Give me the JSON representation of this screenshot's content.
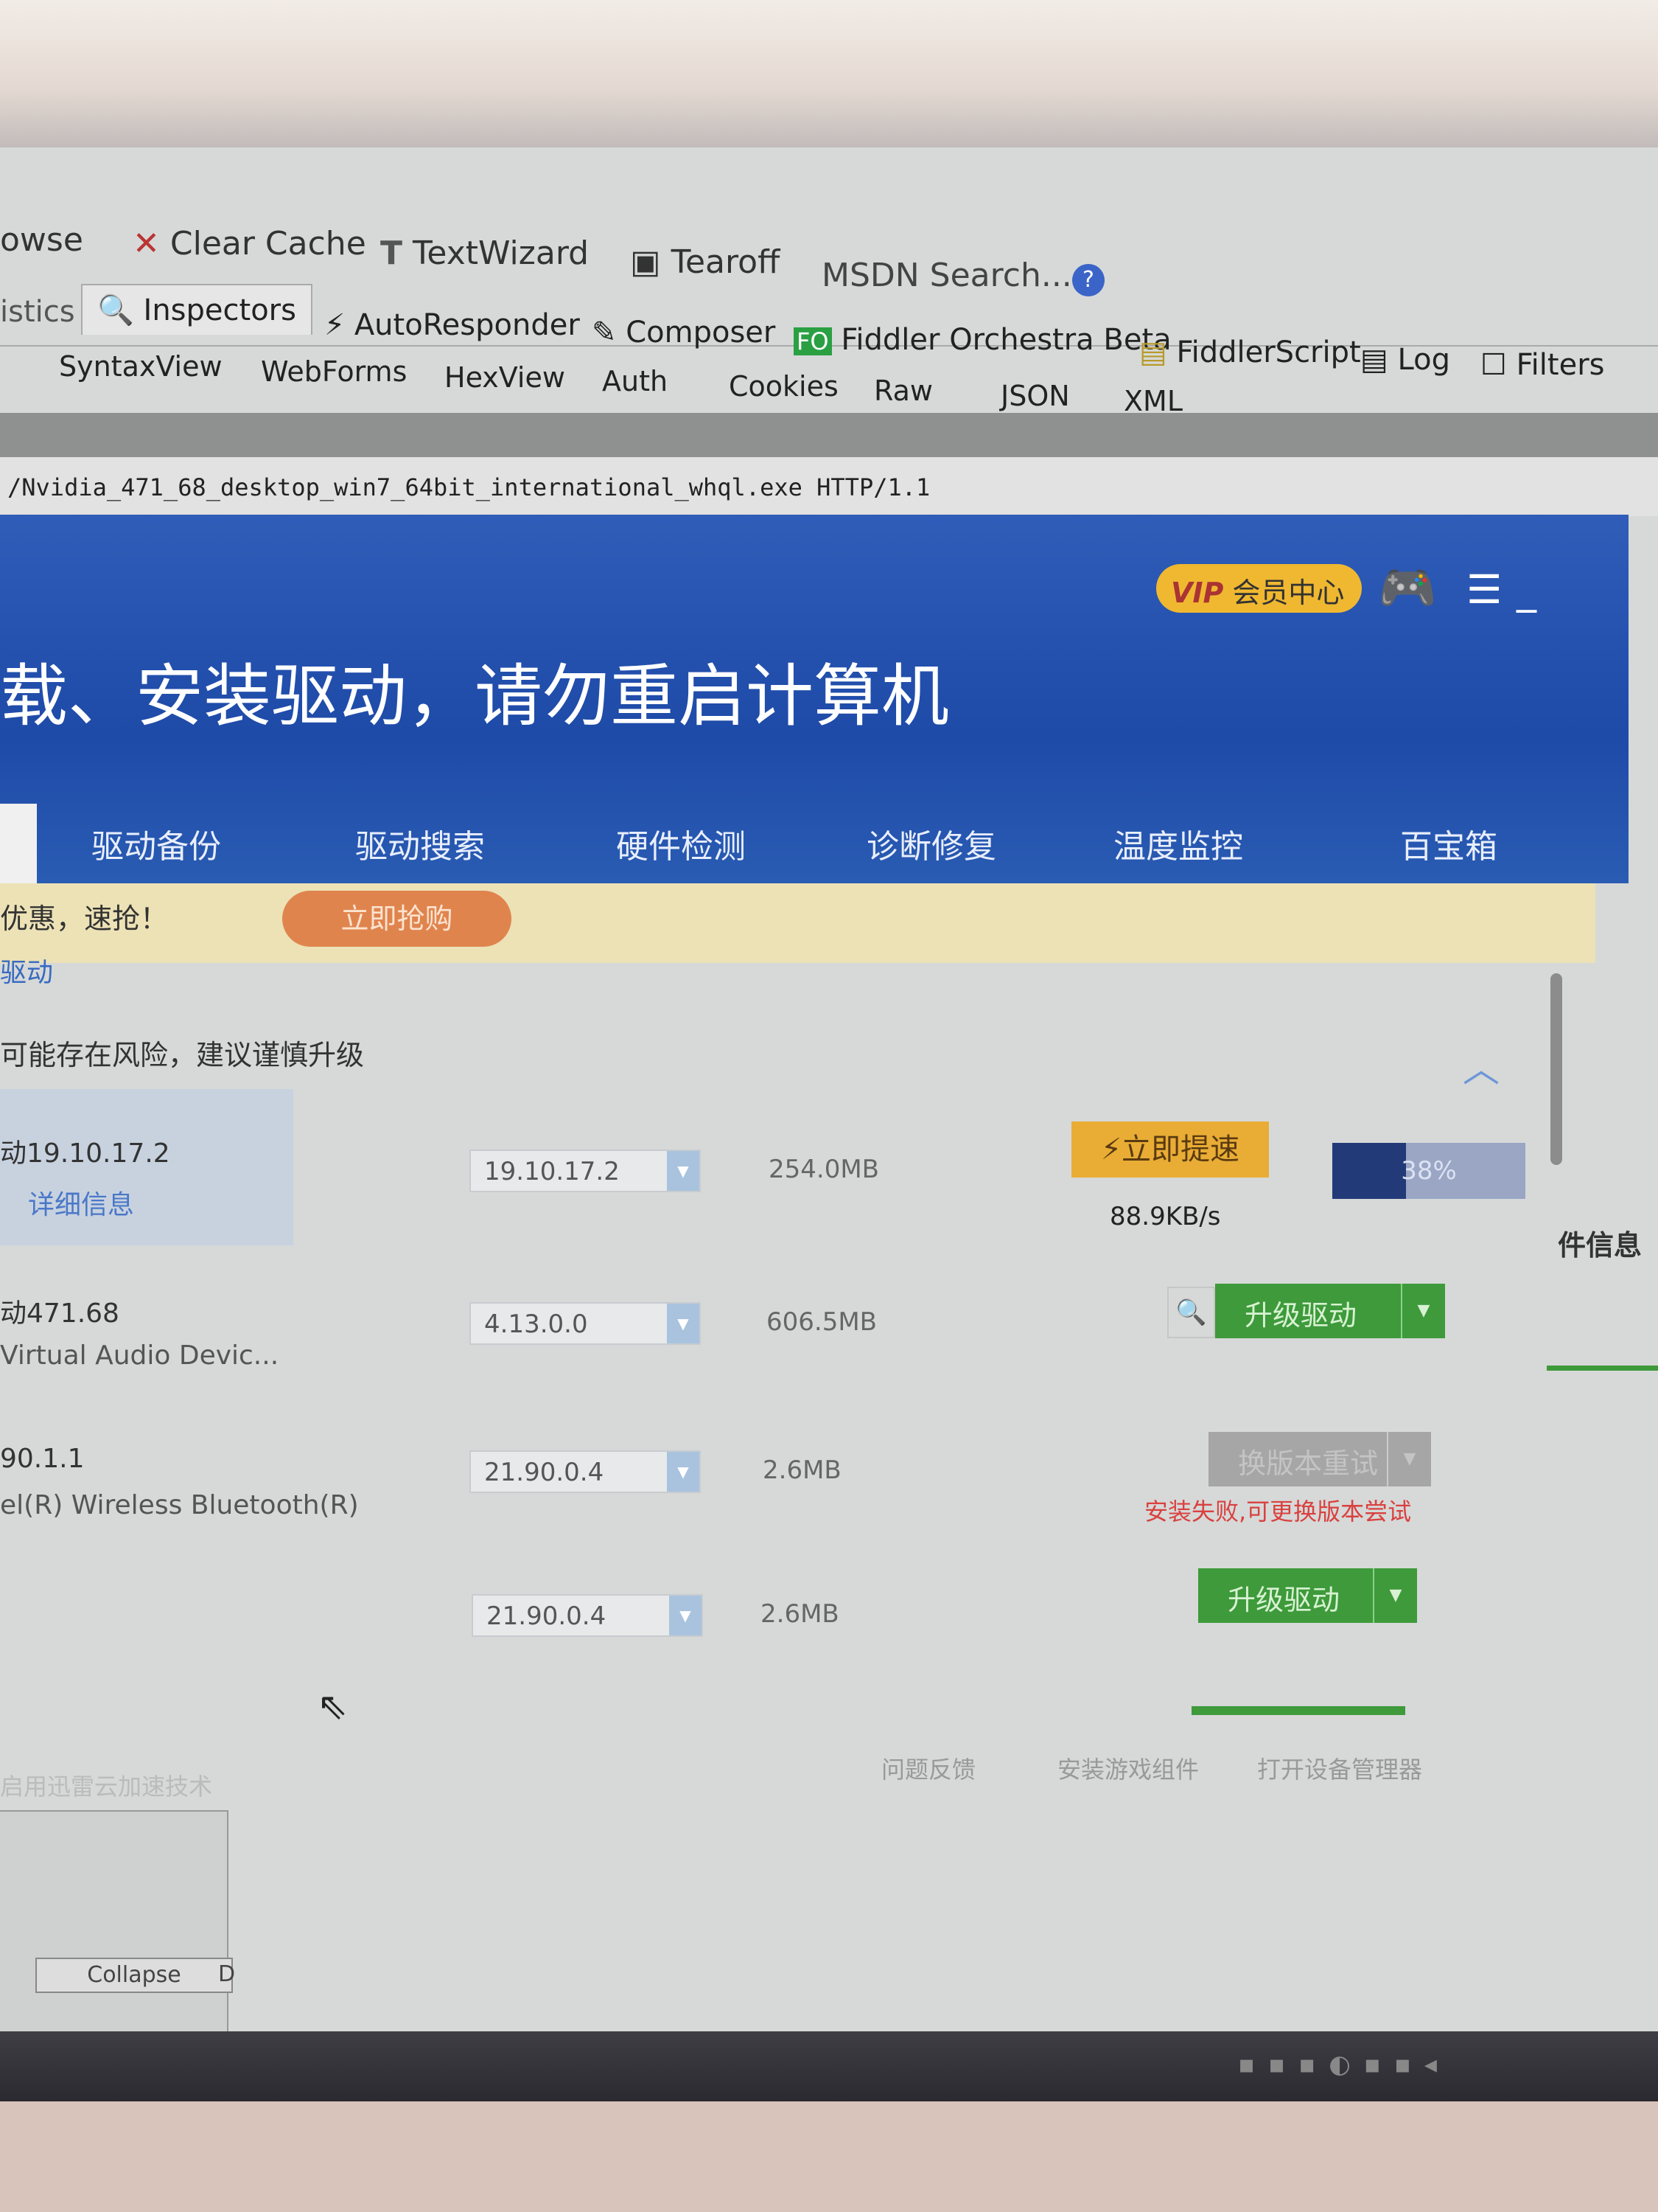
{
  "fiddler": {
    "toolbar": [
      {
        "label": "owse",
        "icon": ""
      },
      {
        "label": "Clear Cache",
        "icon": "clear-cache-icon"
      },
      {
        "label": "TextWizard",
        "icon": "text-wizard-icon"
      },
      {
        "label": "Tearoff",
        "icon": "tearoff-icon"
      },
      {
        "label": "MSDN Search...",
        "icon": ""
      }
    ],
    "tabs": [
      "istics",
      "Inspectors",
      "AutoResponder",
      "Composer",
      "Fiddler Orchestra Beta",
      "FiddlerScript",
      "Log",
      "Filters"
    ],
    "fo_badge": "FO",
    "subtabs": [
      "SyntaxView",
      "WebForms",
      "HexView",
      "Auth",
      "Cookies",
      "Raw",
      "JSON",
      "XML"
    ],
    "request_line": "/Nvidia_471_68_desktop_win7_64bit_international_whql.exe HTTP/1.1",
    "collapse": "Collapse",
    "d_label": "D"
  },
  "app": {
    "vip": "会员中心",
    "vip_badge": "VIP",
    "title": "载、安装驱动，请勿重启计算机",
    "nav": [
      "驱动备份",
      "驱动搜索",
      "硬件检测",
      "诊断修复",
      "温度监控",
      "百宝箱"
    ],
    "promo_text": "优惠，速抢！",
    "promo_button": "立即抢购",
    "section": "驱动",
    "warning": "可能存在风险，建议谨慎升级",
    "side_label": "件信息",
    "rows": [
      {
        "name": "动19.10.17.2",
        "link": "详细信息",
        "version": "19.10.17.2",
        "size": "254.0MB",
        "action": "立即提速",
        "progress_label": "38%",
        "progress": 38,
        "speed": "88.9KB/s"
      },
      {
        "name": "动471.68",
        "desc": "Virtual Audio Devic...",
        "version": "4.13.0.0",
        "size": "606.5MB",
        "action": "升级驱动"
      },
      {
        "name": "90.1.1",
        "desc": "el(R) Wireless Bluetooth(R)",
        "version": "21.90.0.4",
        "size": "2.6MB",
        "action": "换版本重试",
        "error": "安装失败,可更换版本尝试"
      },
      {
        "version": "21.90.0.4",
        "size": "2.6MB",
        "action": "升级驱动"
      }
    ],
    "footer_left": "启用迅雷云加速技术",
    "footer_links": [
      "问题反馈",
      "安装游戏组件",
      "打开设备管理器"
    ]
  },
  "colors": {
    "header_blue": "#2552ae",
    "green": "#3e9a3b",
    "orange": "#e0844e",
    "progress_navy": "#233a78",
    "error_red": "#d9413f"
  }
}
